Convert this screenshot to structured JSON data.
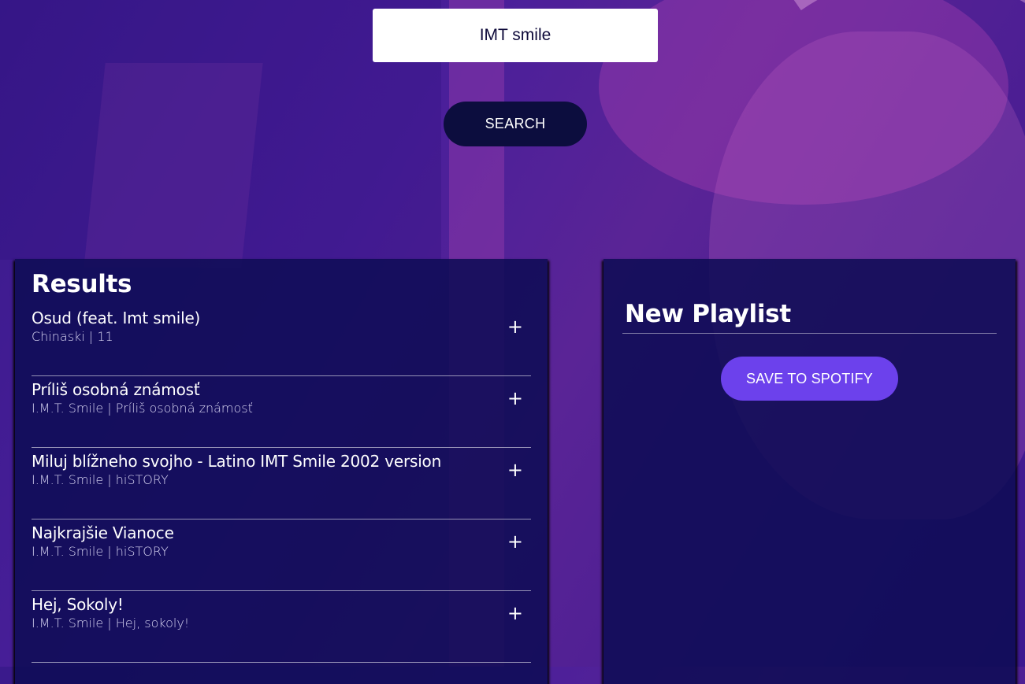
{
  "search": {
    "value": "IMT smile",
    "button_label": "SEARCH"
  },
  "results": {
    "title": "Results",
    "add_symbol": "+",
    "tracks": [
      {
        "name": "Osud (feat. Imt smile)",
        "info": "Chinaski | 11"
      },
      {
        "name": "Príliš osobná známosť",
        "info": "I.M.T. Smile | Príliš osobná známosť"
      },
      {
        "name": "Miluj blížneho svojho - Latino IMT Smile 2002 version",
        "info": "I.M.T. Smile | hiSTORY"
      },
      {
        "name": "Najkrajšie Vianoce",
        "info": "I.M.T. Smile | hiSTORY"
      },
      {
        "name": "Hej, Sokoly!",
        "info": "I.M.T. Smile | Hej, sokoly!"
      }
    ]
  },
  "playlist": {
    "title": "New Playlist",
    "save_label": "SAVE TO SPOTIFY"
  },
  "colors": {
    "panel_bg": "#0d0c54",
    "search_button_bg": "#0c0d3e",
    "save_button_bg": "#6c41ec",
    "background": "#4a1f9a"
  }
}
